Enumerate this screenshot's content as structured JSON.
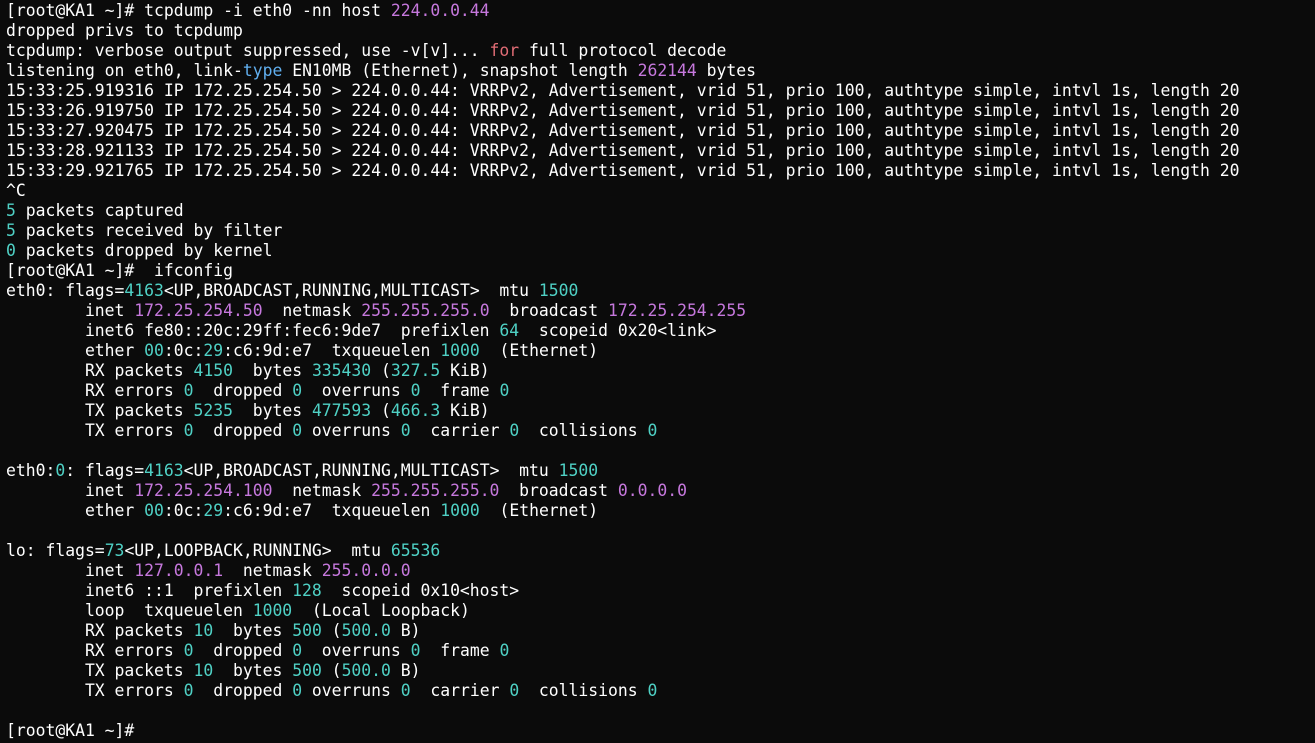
{
  "terminal": {
    "colors": {
      "default": "#ffffff",
      "magenta": "#c678dd",
      "cyan": "#4fd1c5",
      "keyword_red": "#e06c75",
      "keyword_blue": "#61afef",
      "background": "#0b0b0b"
    },
    "lines": [
      [
        {
          "t": "[root@KA1 ~]# tcpdump -i eth0 -nn host "
        },
        {
          "t": "224.0.0.44",
          "c": "magenta"
        }
      ],
      [
        {
          "t": "dropped privs to tcpdump"
        }
      ],
      [
        {
          "t": "tcpdump: verbose output suppressed, use -v[v]... "
        },
        {
          "t": "for",
          "c": "keyword_red"
        },
        {
          "t": " full protocol decode"
        }
      ],
      [
        {
          "t": "listening on eth0, link-"
        },
        {
          "t": "type",
          "c": "keyword_blue"
        },
        {
          "t": " EN10MB (Ethernet), snapshot length "
        },
        {
          "t": "262144",
          "c": "magenta"
        },
        {
          "t": " bytes"
        }
      ],
      [
        {
          "t": "15:33:25.919316 IP 172.25.254.50 > 224.0.0.44: VRRPv2, Advertisement, vrid 51, prio 100, authtype simple, intvl 1s, length 20"
        }
      ],
      [
        {
          "t": "15:33:26.919750 IP 172.25.254.50 > 224.0.0.44: VRRPv2, Advertisement, vrid 51, prio 100, authtype simple, intvl 1s, length 20"
        }
      ],
      [
        {
          "t": "15:33:27.920475 IP 172.25.254.50 > 224.0.0.44: VRRPv2, Advertisement, vrid 51, prio 100, authtype simple, intvl 1s, length 20"
        }
      ],
      [
        {
          "t": "15:33:28.921133 IP 172.25.254.50 > 224.0.0.44: VRRPv2, Advertisement, vrid 51, prio 100, authtype simple, intvl 1s, length 20"
        }
      ],
      [
        {
          "t": "15:33:29.921765 IP 172.25.254.50 > 224.0.0.44: VRRPv2, Advertisement, vrid 51, prio 100, authtype simple, intvl 1s, length 20"
        }
      ],
      [
        {
          "t": "^C"
        }
      ],
      [
        {
          "t": "5",
          "c": "cyan"
        },
        {
          "t": " packets captured"
        }
      ],
      [
        {
          "t": "5",
          "c": "cyan"
        },
        {
          "t": " packets received by filter"
        }
      ],
      [
        {
          "t": "0",
          "c": "cyan"
        },
        {
          "t": " packets dropped by kernel"
        }
      ],
      [
        {
          "t": "[root@KA1 ~]#  ifconfig"
        }
      ],
      [
        {
          "t": "eth0: flags="
        },
        {
          "t": "4163",
          "c": "cyan"
        },
        {
          "t": "<UP,BROADCAST,RUNNING,MULTICAST>  mtu "
        },
        {
          "t": "1500",
          "c": "cyan"
        }
      ],
      [
        {
          "t": "        inet "
        },
        {
          "t": "172.25.254.50",
          "c": "magenta"
        },
        {
          "t": "  netmask "
        },
        {
          "t": "255.255.255.0",
          "c": "magenta"
        },
        {
          "t": "  broadcast "
        },
        {
          "t": "172.25.254.255",
          "c": "magenta"
        }
      ],
      [
        {
          "t": "        inet6 fe80::20c:29ff:fec6:9de7  prefixlen "
        },
        {
          "t": "64",
          "c": "cyan"
        },
        {
          "t": "  scopeid 0x20<link>"
        }
      ],
      [
        {
          "t": "        ether "
        },
        {
          "t": "00",
          "c": "cyan"
        },
        {
          "t": ":0c:"
        },
        {
          "t": "29",
          "c": "cyan"
        },
        {
          "t": ":c6:9d:e7  txqueuelen "
        },
        {
          "t": "1000",
          "c": "cyan"
        },
        {
          "t": "  (Ethernet)"
        }
      ],
      [
        {
          "t": "        RX packets "
        },
        {
          "t": "4150",
          "c": "cyan"
        },
        {
          "t": "  bytes "
        },
        {
          "t": "335430",
          "c": "cyan"
        },
        {
          "t": " ("
        },
        {
          "t": "327.5",
          "c": "cyan"
        },
        {
          "t": " KiB)"
        }
      ],
      [
        {
          "t": "        RX errors "
        },
        {
          "t": "0",
          "c": "cyan"
        },
        {
          "t": "  dropped "
        },
        {
          "t": "0",
          "c": "cyan"
        },
        {
          "t": "  overruns "
        },
        {
          "t": "0",
          "c": "cyan"
        },
        {
          "t": "  frame "
        },
        {
          "t": "0",
          "c": "cyan"
        }
      ],
      [
        {
          "t": "        TX packets "
        },
        {
          "t": "5235",
          "c": "cyan"
        },
        {
          "t": "  bytes "
        },
        {
          "t": "477593",
          "c": "cyan"
        },
        {
          "t": " ("
        },
        {
          "t": "466.3",
          "c": "cyan"
        },
        {
          "t": " KiB)"
        }
      ],
      [
        {
          "t": "        TX errors "
        },
        {
          "t": "0",
          "c": "cyan"
        },
        {
          "t": "  dropped "
        },
        {
          "t": "0",
          "c": "cyan"
        },
        {
          "t": " overruns "
        },
        {
          "t": "0",
          "c": "cyan"
        },
        {
          "t": "  carrier "
        },
        {
          "t": "0",
          "c": "cyan"
        },
        {
          "t": "  collisions "
        },
        {
          "t": "0",
          "c": "cyan"
        }
      ],
      [
        {
          "t": ""
        }
      ],
      [
        {
          "t": "eth0:"
        },
        {
          "t": "0",
          "c": "cyan"
        },
        {
          "t": ": flags="
        },
        {
          "t": "4163",
          "c": "cyan"
        },
        {
          "t": "<UP,BROADCAST,RUNNING,MULTICAST>  mtu "
        },
        {
          "t": "1500",
          "c": "cyan"
        }
      ],
      [
        {
          "t": "        inet "
        },
        {
          "t": "172.25.254.100",
          "c": "magenta"
        },
        {
          "t": "  netmask "
        },
        {
          "t": "255.255.255.0",
          "c": "magenta"
        },
        {
          "t": "  broadcast "
        },
        {
          "t": "0.0.0.0",
          "c": "magenta"
        }
      ],
      [
        {
          "t": "        ether "
        },
        {
          "t": "00",
          "c": "cyan"
        },
        {
          "t": ":0c:"
        },
        {
          "t": "29",
          "c": "cyan"
        },
        {
          "t": ":c6:9d:e7  txqueuelen "
        },
        {
          "t": "1000",
          "c": "cyan"
        },
        {
          "t": "  (Ethernet)"
        }
      ],
      [
        {
          "t": ""
        }
      ],
      [
        {
          "t": "lo: flags="
        },
        {
          "t": "73",
          "c": "cyan"
        },
        {
          "t": "<UP,LOOPBACK,RUNNING>  mtu "
        },
        {
          "t": "65536",
          "c": "cyan"
        }
      ],
      [
        {
          "t": "        inet "
        },
        {
          "t": "127.0.0.1",
          "c": "magenta"
        },
        {
          "t": "  netmask "
        },
        {
          "t": "255.0.0.0",
          "c": "magenta"
        }
      ],
      [
        {
          "t": "        inet6 ::1  prefixlen "
        },
        {
          "t": "128",
          "c": "cyan"
        },
        {
          "t": "  scopeid 0x10<host>"
        }
      ],
      [
        {
          "t": "        loop  txqueuelen "
        },
        {
          "t": "1000",
          "c": "cyan"
        },
        {
          "t": "  (Local Loopback)"
        }
      ],
      [
        {
          "t": "        RX packets "
        },
        {
          "t": "10",
          "c": "cyan"
        },
        {
          "t": "  bytes "
        },
        {
          "t": "500",
          "c": "cyan"
        },
        {
          "t": " ("
        },
        {
          "t": "500.0",
          "c": "cyan"
        },
        {
          "t": " B)"
        }
      ],
      [
        {
          "t": "        RX errors "
        },
        {
          "t": "0",
          "c": "cyan"
        },
        {
          "t": "  dropped "
        },
        {
          "t": "0",
          "c": "cyan"
        },
        {
          "t": "  overruns "
        },
        {
          "t": "0",
          "c": "cyan"
        },
        {
          "t": "  frame "
        },
        {
          "t": "0",
          "c": "cyan"
        }
      ],
      [
        {
          "t": "        TX packets "
        },
        {
          "t": "10",
          "c": "cyan"
        },
        {
          "t": "  bytes "
        },
        {
          "t": "500",
          "c": "cyan"
        },
        {
          "t": " ("
        },
        {
          "t": "500.0",
          "c": "cyan"
        },
        {
          "t": " B)"
        }
      ],
      [
        {
          "t": "        TX errors "
        },
        {
          "t": "0",
          "c": "cyan"
        },
        {
          "t": "  dropped "
        },
        {
          "t": "0",
          "c": "cyan"
        },
        {
          "t": " overruns "
        },
        {
          "t": "0",
          "c": "cyan"
        },
        {
          "t": "  carrier "
        },
        {
          "t": "0",
          "c": "cyan"
        },
        {
          "t": "  collisions "
        },
        {
          "t": "0",
          "c": "cyan"
        }
      ],
      [
        {
          "t": ""
        }
      ],
      [
        {
          "t": "[root@KA1 ~]#"
        }
      ]
    ]
  }
}
